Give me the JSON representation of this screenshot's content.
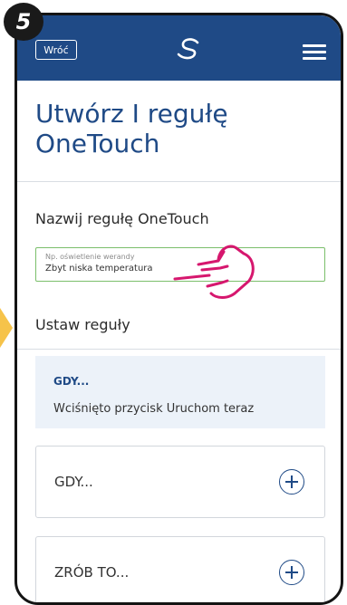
{
  "step_number": "5",
  "header": {
    "back_label": "Wróć"
  },
  "page": {
    "title_line1": "Utwórz I regułę",
    "title_line2": "OneTouch"
  },
  "name_field": {
    "label": "Nazwij regułę OneTouch",
    "placeholder": "Np. oświetlenie werandy",
    "value": "Zbyt niska temperatura"
  },
  "rules": {
    "heading": "Ustaw reguły",
    "existing_condition": {
      "tag": "GDY...",
      "description": "Wciśnięto przycisk Uruchom teraz"
    },
    "add_condition_label": "GDY...",
    "add_action_label": "ZRÓB TO..."
  },
  "colors": {
    "primary": "#1f4a86",
    "input_border": "#7bbf6b",
    "highlight_bg": "#ecf2f9",
    "hand_accent": "#d6176e",
    "arrow": "#f6c34a"
  }
}
